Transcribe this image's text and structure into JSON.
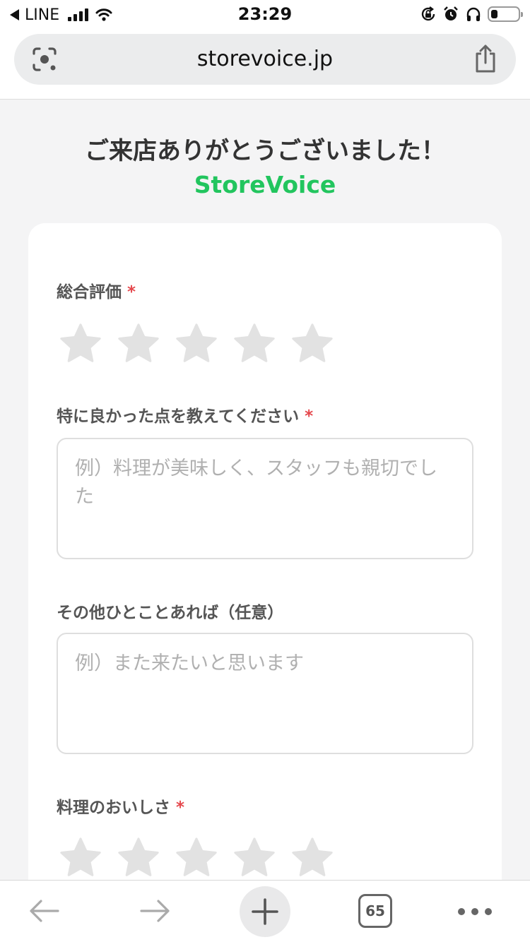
{
  "status_bar": {
    "back_app": "LINE",
    "time": "23:29",
    "icons": [
      "back-arrow-icon",
      "signal-icon",
      "wifi-icon",
      "rotation-lock-icon",
      "alarm-icon",
      "headphones-icon",
      "battery-icon"
    ]
  },
  "browser": {
    "url": "storevoice.jp",
    "tab_count": "65",
    "icons": [
      "lens-icon",
      "share-icon",
      "back-icon",
      "forward-icon",
      "plus-icon",
      "tabs-icon",
      "more-icon"
    ]
  },
  "page": {
    "thanks": "ご来店ありがとうございました！",
    "brand": "StoreVoice",
    "brand_color": "#22c55e"
  },
  "form": {
    "required_mark": "*",
    "overall": {
      "label": "総合評価",
      "rating": 0,
      "max": 5
    },
    "good_points": {
      "label": "特に良かった点を教えてください",
      "placeholder": "例）料理が美味しく、スタッフも親切でした",
      "value": ""
    },
    "other": {
      "label": "その他ひとことあれば（任意）",
      "placeholder": "例）また来たいと思います",
      "value": ""
    },
    "food": {
      "label": "料理のおいしさ",
      "rating": 0,
      "max": 5
    }
  },
  "colors": {
    "star_empty": "#e2e2e2",
    "required": "#e5484d"
  }
}
